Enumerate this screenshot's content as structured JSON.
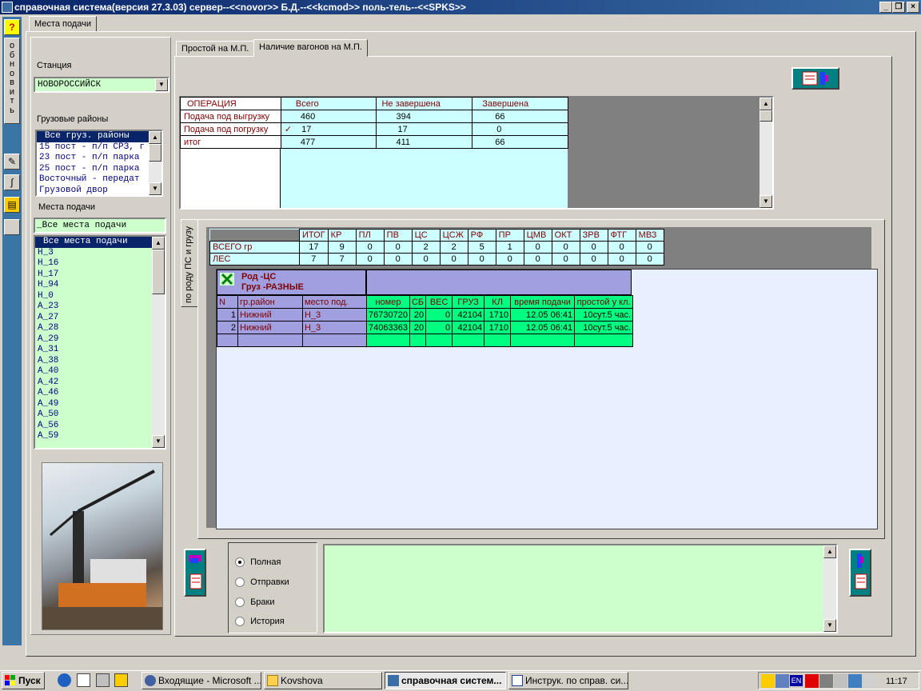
{
  "window": {
    "title": "справочная система(версия 27.3.03) сервер--<<novor>> Б.Д.--<<kcmod>> поль-тель--<<SPKS>>"
  },
  "left_toolbar": {
    "help": "?",
    "refresh_label": "обновить"
  },
  "outer_tab": "Места подачи",
  "station": {
    "label": "Станция",
    "value": "НОВОРОССИЙСК"
  },
  "cargo_regions": {
    "label": "Грузовые районы",
    "items": [
      "Все груз. районы",
      "15 пост - п/п СРЗ, г",
      "23 пост - п/п парка",
      "25 пост - п/п парка",
      "Восточный -  передат",
      "Грузовой двор"
    ]
  },
  "delivery_places": {
    "label": "Места подачи",
    "filter": "_Все места подачи",
    "items": [
      "Все места подачи",
      "Н_3",
      "Н_16",
      "Н_17",
      "Н_94",
      "Н_0",
      "А_23",
      "А_27",
      "А_28",
      "А_29",
      "А_31",
      "А_38",
      "А_40",
      "А_42",
      "А_46",
      "А_49",
      "А_50",
      "А_56",
      "А_59"
    ]
  },
  "tabs": [
    "Простой на М.П.",
    "Наличие вагонов на М.П."
  ],
  "ops": {
    "headers": [
      "ОПЕРАЦИЯ",
      "Всего",
      "Не завершена",
      "Завершена"
    ],
    "rows": [
      [
        "Подача под выгрузку",
        "460",
        "394",
        "66"
      ],
      [
        "Подача под погрузку",
        "17",
        "17",
        "0"
      ],
      [
        "итог",
        "477",
        "411",
        "66"
      ]
    ],
    "check": "✓"
  },
  "side_tab": "по роду ПС и грузу",
  "summary": {
    "headers": [
      "",
      "ИТОГ",
      "КР",
      "ПЛ",
      "ПВ",
      "ЦС",
      "ЦСЖ",
      "РФ",
      "ПР",
      "ЦМВ",
      "ОКТ",
      "ЗРВ",
      "ФТГ",
      "МВЗ"
    ],
    "rows": [
      [
        "ВСЕГО  гр",
        "17",
        "9",
        "0",
        "0",
        "2",
        "2",
        "5",
        "1",
        "0",
        "0",
        "0",
        "0",
        "0"
      ],
      [
        "ЛЕС",
        "7",
        "7",
        "0",
        "0",
        "0",
        "0",
        "0",
        "0",
        "0",
        "0",
        "0",
        "0",
        "0"
      ]
    ]
  },
  "detail": {
    "title1": "Род -ЦС",
    "title2": "Груз -РАЗНЫЕ",
    "headers": [
      "N",
      "гр.район",
      "место под.",
      "номер",
      "СБ",
      "ВЕС",
      "ГРУЗ",
      "КЛ",
      "время подачи",
      "простой у кл."
    ],
    "rows": [
      [
        "1",
        "Нижний",
        "Н_3",
        "76730720",
        "20",
        "0",
        "42104",
        "1710",
        "12.05 06:41",
        "10сут.5 час."
      ],
      [
        "2",
        "Нижний",
        "Н_3",
        "74063363",
        "20",
        "0",
        "42104",
        "1710",
        "12.05 06:41",
        "10сут.5 час."
      ]
    ]
  },
  "radios": [
    "Полная",
    "Отправки",
    "Браки",
    "История"
  ],
  "taskbar": {
    "start": "Пуск",
    "tasks": [
      "Входящие - Microsoft ...",
      "Kovshova",
      "справочная систем...",
      "Инструк. по справ. си..."
    ],
    "lang": "EN",
    "clock": "11:17"
  },
  "colors": {
    "cyan": "#ccffff",
    "green": "#00ff80",
    "purple": "#a0a0e0",
    "dark_red": "#800000",
    "navy": "#0a246a"
  }
}
